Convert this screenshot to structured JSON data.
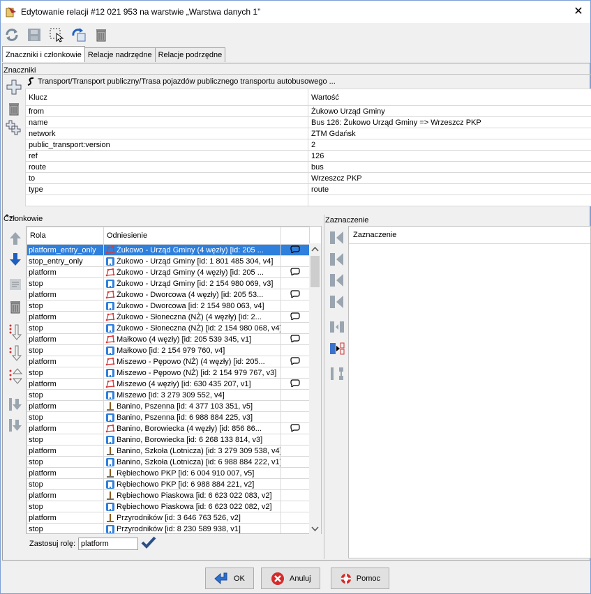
{
  "window": {
    "title": "Edytowanie relacji #12 021 953 na warstwie „Warstwa danych 1”",
    "close_glyph": "✕"
  },
  "tabs": [
    {
      "label": "Znaczniki i członkowie",
      "active": true
    },
    {
      "label": "Relacje nadrzędne",
      "active": false
    },
    {
      "label": "Relacje podrzędne",
      "active": false
    }
  ],
  "tags": {
    "section_label": "Znaczniki",
    "preset": "Transport/Transport publiczny/Trasa pojazdów publicznego transportu autobusowego ...",
    "headers": {
      "key": "Klucz",
      "value": "Wartość"
    },
    "rows": [
      {
        "key": "from",
        "value": "Żukowo Urząd Gminy"
      },
      {
        "key": "name",
        "value": "Bus 126: Żukowo Urząd Gminy => Wrzeszcz PKP"
      },
      {
        "key": "network",
        "value": "ZTM Gdańsk"
      },
      {
        "key": "public_transport:version",
        "value": "2"
      },
      {
        "key": "ref",
        "value": "126"
      },
      {
        "key": "route",
        "value": "bus"
      },
      {
        "key": "to",
        "value": "Wrzeszcz PKP"
      },
      {
        "key": "type",
        "value": "route"
      },
      {
        "key": "",
        "value": ""
      }
    ]
  },
  "members": {
    "section_label": "Członkowie",
    "headers": {
      "role": "Rola",
      "ref": "Odniesienie"
    },
    "rows": [
      {
        "role": "platform_entry_only",
        "ref": "Żukowo - Urząd Gminy (4 węzły) [id: 205 ...",
        "icon": "way-icon",
        "link": "loop",
        "selected": true
      },
      {
        "role": "stop_entry_only",
        "ref": "Żukowo - Urząd Gminy [id: 1 801 485 304, v4]",
        "icon": "bus-stop-icon",
        "link": "",
        "selected": false
      },
      {
        "role": "platform",
        "ref": "Żukowo - Urząd Gminy (4 węzły) [id: 205 ...",
        "icon": "way-icon",
        "link": "loop",
        "selected": false
      },
      {
        "role": "stop",
        "ref": "Żukowo - Urząd Gminy [id: 2 154 980 069, v3]",
        "icon": "bus-stop-icon",
        "link": "",
        "selected": false
      },
      {
        "role": "platform",
        "ref": "Żukowo - Dworcowa (4 węzły) [id: 205 53...",
        "icon": "way-icon",
        "link": "loop",
        "selected": false
      },
      {
        "role": "stop",
        "ref": "Żukowo - Dworcowa [id: 2 154 980 063, v4]",
        "icon": "bus-stop-icon",
        "link": "",
        "selected": false
      },
      {
        "role": "platform",
        "ref": "Żukowo - Słoneczna (NŻ) (4 węzły) [id: 2...",
        "icon": "way-icon",
        "link": "loop",
        "selected": false
      },
      {
        "role": "stop",
        "ref": "Żukowo - Słoneczna (NŻ) [id: 2 154 980 068, v4]",
        "icon": "bus-stop-icon",
        "link": "",
        "selected": false
      },
      {
        "role": "platform",
        "ref": "Małkowo (4 węzły) [id: 205 539 345, v1]",
        "icon": "way-icon",
        "link": "loop",
        "selected": false
      },
      {
        "role": "stop",
        "ref": "Małkowo [id: 2 154 979 760, v4]",
        "icon": "bus-stop-icon",
        "link": "",
        "selected": false
      },
      {
        "role": "platform",
        "ref": "Miszewo - Pępowo (NŻ) (4 węzły) [id: 205...",
        "icon": "way-icon",
        "link": "loop",
        "selected": false
      },
      {
        "role": "stop",
        "ref": "Miszewo - Pępowo (NŻ) [id: 2 154 979 767, v3]",
        "icon": "bus-stop-icon",
        "link": "",
        "selected": false
      },
      {
        "role": "platform",
        "ref": "Miszewo (4 węzły) [id: 630 435 207, v1]",
        "icon": "way-icon",
        "link": "loop",
        "selected": false
      },
      {
        "role": "stop",
        "ref": "Miszewo [id: 3 279 309 552, v4]",
        "icon": "bus-stop-icon",
        "link": "",
        "selected": false
      },
      {
        "role": "platform",
        "ref": "Banino, Pszenna [id: 4 377 103 351, v5]",
        "icon": "platform-node-icon",
        "link": "",
        "selected": false
      },
      {
        "role": "stop",
        "ref": "Banino, Pszenna [id: 6 988 884 225, v3]",
        "icon": "bus-stop-icon",
        "link": "",
        "selected": false
      },
      {
        "role": "platform",
        "ref": "Banino, Borowiecka (4 węzły) [id: 856 86...",
        "icon": "way-icon",
        "link": "loop",
        "selected": false
      },
      {
        "role": "stop",
        "ref": "Banino, Borowiecka [id: 6 268 133 814, v3]",
        "icon": "bus-stop-icon",
        "link": "",
        "selected": false
      },
      {
        "role": "platform",
        "ref": "Banino, Szkoła (Lotnicza) [id: 3 279 309 538, v4]",
        "icon": "platform-node-icon",
        "link": "",
        "selected": false
      },
      {
        "role": "stop",
        "ref": "Banino, Szkoła (Lotnicza) [id: 6 988 884 222, v1]",
        "icon": "bus-stop-icon",
        "link": "",
        "selected": false
      },
      {
        "role": "platform",
        "ref": "Rębiechowo PKP [id: 6 004 910 007, v5]",
        "icon": "platform-node-icon",
        "link": "",
        "selected": false
      },
      {
        "role": "stop",
        "ref": "Rębiechowo PKP [id: 6 988 884 221, v2]",
        "icon": "bus-stop-icon",
        "link": "",
        "selected": false
      },
      {
        "role": "platform",
        "ref": "Rębiechowo Piaskowa [id: 6 623 022 083, v2]",
        "icon": "platform-node-icon",
        "link": "",
        "selected": false
      },
      {
        "role": "stop",
        "ref": "Rębiechowo Piaskowa [id: 6 623 022 082, v2]",
        "icon": "bus-stop-icon",
        "link": "",
        "selected": false
      },
      {
        "role": "platform",
        "ref": "Przyrodników [id: 3 646 763 526, v2]",
        "icon": "platform-node-icon",
        "link": "",
        "selected": false
      },
      {
        "role": "stop",
        "ref": "Przyrodników [id: 8 230 589 938, v1]",
        "icon": "bus-stop-icon",
        "link": "",
        "selected": false
      }
    ],
    "apply_role_label": "Zastosuj rolę:",
    "apply_role_value": "platform"
  },
  "selection": {
    "section_label": "Zaznaczenie",
    "header": "Zaznaczenie"
  },
  "buttons": {
    "ok": "OK",
    "cancel": "Anuluj",
    "help": "Pomoc"
  },
  "colors": {
    "selection_bg": "#2f7fdc",
    "accent_blue": "#1e5fbf",
    "way_red": "#d83a3a"
  }
}
